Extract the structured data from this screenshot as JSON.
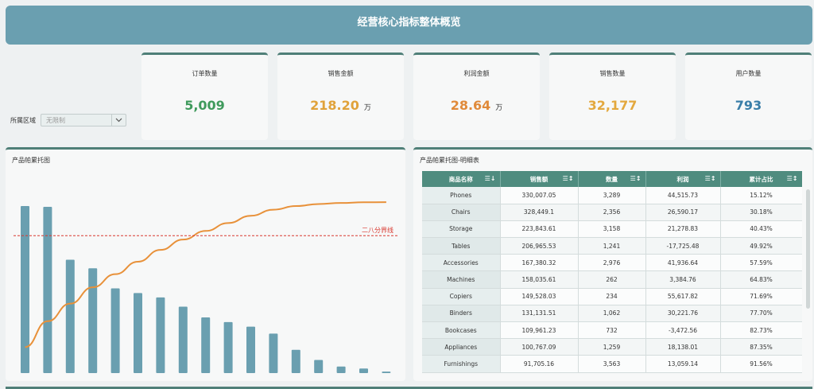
{
  "header": {
    "title": "经营核心指标整体概览"
  },
  "filter": {
    "label": "所属区域",
    "value": "无限制"
  },
  "kpis": [
    {
      "label": "订单数量",
      "value": "5,009",
      "unit": "",
      "color": "#3f9a5c"
    },
    {
      "label": "销售金额",
      "value": "218.20",
      "unit": "万",
      "color": "#e0a23a"
    },
    {
      "label": "利润金额",
      "value": "28.64",
      "unit": "万",
      "color": "#e08a3a"
    },
    {
      "label": "销售数量",
      "value": "32,177",
      "unit": "",
      "color": "#e3a83e"
    },
    {
      "label": "用户数量",
      "value": "793",
      "unit": "",
      "color": "#3a7ea8"
    }
  ],
  "chart_panel": {
    "title": "产品帕累托图"
  },
  "table_panel": {
    "title": "产品帕累托图-明细表",
    "columns": [
      "商品名称",
      "销售额",
      "数量",
      "利润",
      "累计占比"
    ],
    "rows": [
      [
        "Phones",
        "330,007.05",
        "3,289",
        "44,515.73",
        "15.12%"
      ],
      [
        "Chairs",
        "328,449.1",
        "2,356",
        "26,590.17",
        "30.18%"
      ],
      [
        "Storage",
        "223,843.61",
        "3,158",
        "21,278.83",
        "40.43%"
      ],
      [
        "Tables",
        "206,965.53",
        "1,241",
        "-17,725.48",
        "49.92%"
      ],
      [
        "Accessories",
        "167,380.32",
        "2,976",
        "41,936.64",
        "57.59%"
      ],
      [
        "Machines",
        "158,035.61",
        "262",
        "3,384.76",
        "64.83%"
      ],
      [
        "Copiers",
        "149,528.03",
        "234",
        "55,617.82",
        "71.69%"
      ],
      [
        "Binders",
        "131,131.51",
        "1,062",
        "30,221.76",
        "77.70%"
      ],
      [
        "Bookcases",
        "109,961.23",
        "732",
        "-3,472.56",
        "82.73%"
      ],
      [
        "Appliances",
        "100,767.09",
        "1,259",
        "18,138.01",
        "87.35%"
      ],
      [
        "Furnishings",
        "91,705.16",
        "3,563",
        "13,059.14",
        "91.56%"
      ]
    ]
  },
  "chart_data": {
    "type": "bar",
    "title": "产品帕累托图",
    "values": [
      330007.05,
      328449.1,
      223843.61,
      206965.53,
      167380.32,
      158035.61,
      149528.03,
      131131.51,
      109961.23,
      100767.09,
      91705.16,
      78000,
      46000,
      26000,
      13000,
      9000,
      3000
    ],
    "cumulative_pct": [
      15.12,
      30.18,
      40.43,
      49.92,
      57.59,
      64.83,
      71.69,
      77.7,
      82.73,
      87.35,
      91.56,
      95.1,
      97.2,
      98.4,
      99.0,
      99.4,
      99.5
    ],
    "threshold_pct": 80,
    "threshold_label": "二八分界线",
    "bar_color": "#6a9fb0",
    "line_color": "#e8913a",
    "threshold_color": "#d9382f"
  }
}
